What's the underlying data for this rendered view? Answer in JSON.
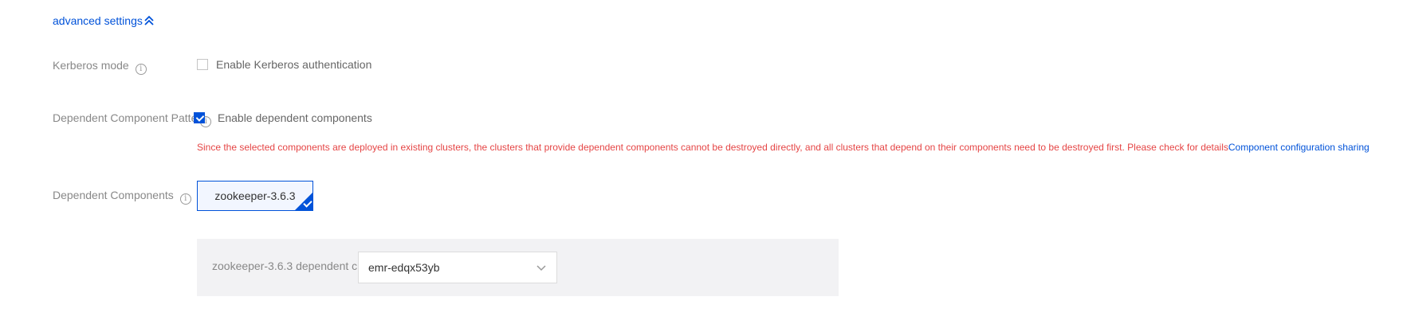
{
  "advanced_settings": {
    "label": "advanced settings",
    "icon": "double-chevron-up-icon",
    "color": "#0052d9"
  },
  "kerberos": {
    "label": "Kerberos mode",
    "info_icon": "info-icon",
    "checkbox_label": "Enable Kerberos authentication",
    "checked": false
  },
  "dependent_pattern": {
    "label": "Dependent Component Patte",
    "info_icon": "info-icon",
    "checkbox_label": "Enable dependent components",
    "checked": true
  },
  "warning": {
    "text": "Since the selected components are deployed in existing clusters, the clusters that provide dependent components cannot be destroyed directly, and all clusters that depend on their components need to be destroyed first. Please check for details",
    "link": "Component configuration sharing",
    "color": "#e54545"
  },
  "dependent_components": {
    "label": "Dependent Components",
    "info_icon": "info-icon",
    "tiles": [
      {
        "label": "zookeeper-3.6.3",
        "selected": true
      }
    ]
  },
  "dependency_panel": {
    "label": "zookeeper-3.6.3 dependent c",
    "select_value": "emr-edqx53yb",
    "select_icon": "chevron-down-icon"
  },
  "accent_color": "#0052d9"
}
